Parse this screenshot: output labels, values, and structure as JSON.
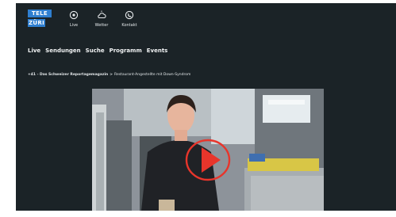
{
  "header": {
    "logo": {
      "line1": "TELE",
      "line2": "ZÜRI"
    },
    "quick_links": [
      {
        "label": "Live",
        "icon": "live-icon"
      },
      {
        "label": "Wetter",
        "icon": "weather-icon"
      },
      {
        "label": "Kontakt",
        "icon": "contact-icon"
      }
    ]
  },
  "nav": {
    "items": [
      "Live",
      "Sendungen",
      "Suche",
      "Programm",
      "Events"
    ]
  },
  "breadcrumb": {
    "section": "+41 - Das Schweizer Reportagemagazin",
    "separator": ">",
    "current": "Restaurant-Angestellte mit Down-Syndrom"
  },
  "video": {
    "play_icon": "play-icon",
    "colors": {
      "play_ring": "#e8352b",
      "play_fill": "#e8352b"
    }
  },
  "colors": {
    "background": "#1b2327",
    "logo_blue": "#2f7fd0",
    "text": "#f1f3f4"
  }
}
